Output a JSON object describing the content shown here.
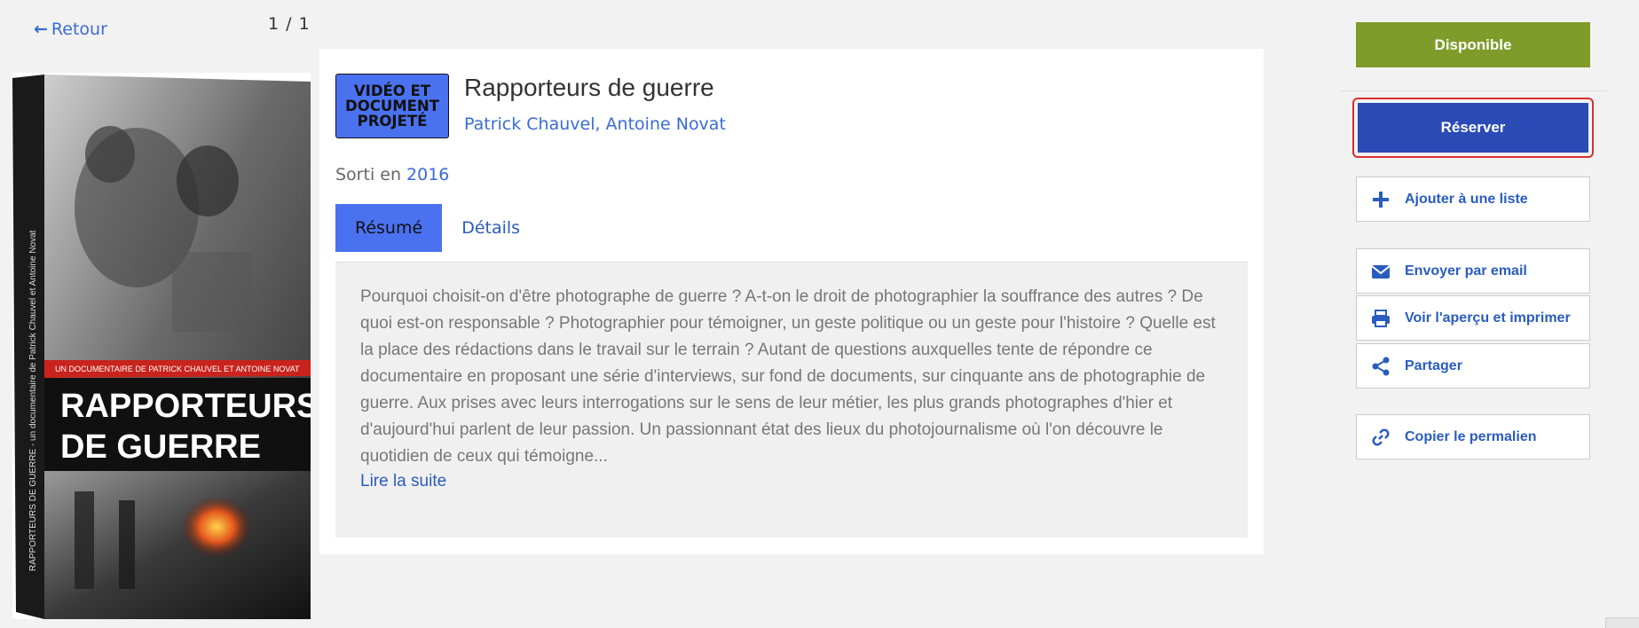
{
  "nav": {
    "back_label": "Retour",
    "pager": "1 / 1"
  },
  "cover": {
    "banner": "UN DOCUMENTAIRE DE PATRICK CHAUVEL ET ANTOINE NOVAT",
    "title_line1": "RAPPORTEURS",
    "title_line2": "DE GUERRE",
    "spine": "RAPPORTEURS DE GUERRE - un documentaire de Patrick Chauvel et Antoine Novat"
  },
  "record": {
    "format_badge": "VIDÉO ET\nDOCUMENT\nPROJETÉ",
    "title": "Rapporteurs de guerre",
    "authors": "Patrick Chauvel, Antoine Novat",
    "release_prefix": "Sorti en",
    "release_year": "2016",
    "tabs": [
      {
        "label": "Résumé"
      },
      {
        "label": "Détails"
      }
    ],
    "summary": "Pourquoi choisit-on d'être photographe de guerre ? A-t-on le droit de photographier la souffrance des autres ? De quoi est-on responsable ? Photographier pour témoigner, un geste politique ou un geste pour l'histoire ? Quelle est la place des rédactions dans le travail sur le terrain ? Autant de questions auxquelles tente de répondre ce documentaire en proposant une série d'interviews, sur fond de documents, sur cinquante ans de photographie de guerre. Aux prises avec leurs interrogations sur le sens de leur métier, les plus grands photographes d'hier et d'aujourd'hui parlent de leur passion. Un passionnant état des lieux du photojournalisme où l'on découvre le quotidien de ceux qui témoigne...",
    "read_more": "Lire la suite"
  },
  "sidebar": {
    "availability": "Disponible",
    "reserve": "Réserver",
    "actions": [
      {
        "label": "Ajouter à une liste",
        "icon": "plus-icon"
      },
      {
        "label": "Envoyer par email",
        "icon": "envelope-icon"
      },
      {
        "label": "Voir l'aperçu et imprimer",
        "icon": "printer-icon"
      },
      {
        "label": "Partager",
        "icon": "share-icon"
      },
      {
        "label": "Copier le permalien",
        "icon": "link-icon"
      }
    ]
  },
  "colors": {
    "link": "#3a6bd6",
    "available": "#7f9c2a",
    "reserve": "#2a4bb5",
    "active_tab": "#4a72f0",
    "highlight_border": "#d83030"
  }
}
